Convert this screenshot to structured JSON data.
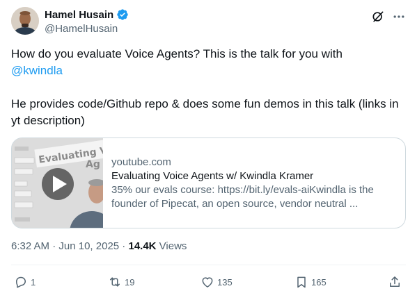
{
  "author": {
    "name": "Hamel Husain",
    "handle": "@HamelHusain",
    "verified": true
  },
  "tweet": {
    "line1": "How do you evaluate Voice Agents?  This is the talk for you with",
    "mention": "@kwindla",
    "line2": "He provides code/Github repo & does some fun demos in this talk (links in yt description)"
  },
  "card": {
    "domain": "youtube.com",
    "title": "Evaluating Voice Agents w/ Kwindla Kramer",
    "description": "35% our evals course: https://bit.ly/evals-aiKwindla is the founder of Pipecat, an open source, vendor neutral ...",
    "thumb_title": "Evaluating V",
    "thumb_title_2": "Ag"
  },
  "meta": {
    "time": "6:32 AM",
    "sep1": " · ",
    "date": "Jun 10, 2025",
    "sep2": " · ",
    "views_count": "14.4K",
    "views_label": " Views"
  },
  "actions": {
    "replies": "1",
    "reposts": "19",
    "likes": "135",
    "bookmarks": "165"
  },
  "colors": {
    "link": "#1d9bf0",
    "verified": "#1d9bf0",
    "secondary": "#536471",
    "primary": "#0f1419",
    "border": "#cfd9de"
  }
}
